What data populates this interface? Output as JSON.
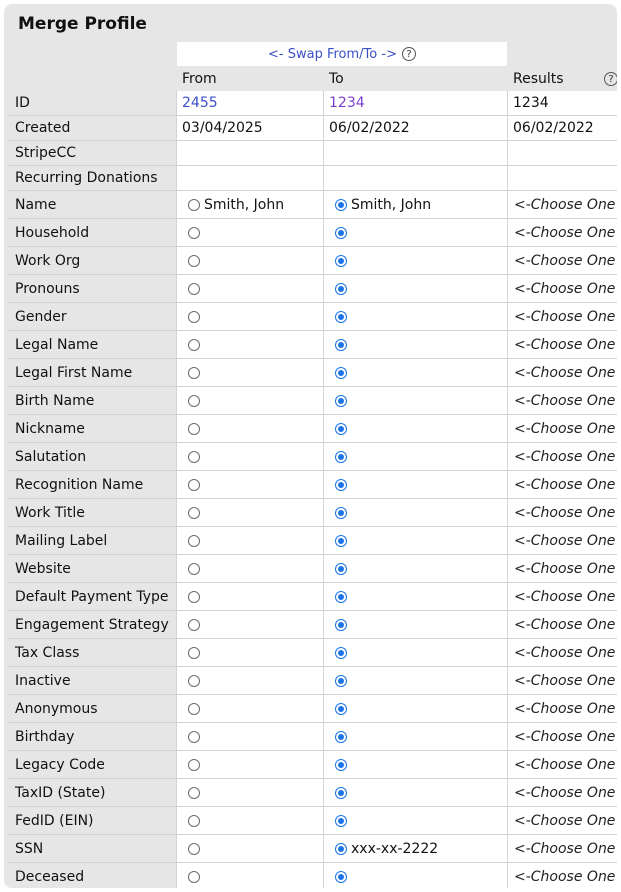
{
  "title": "Merge Profile",
  "swap": {
    "label": "<- Swap From/To ->",
    "help_icon": "?"
  },
  "columns": {
    "from": "From",
    "to": "To",
    "results": "Results"
  },
  "top_rows": [
    {
      "label": "ID",
      "from": "2455",
      "to": "1234",
      "result": "1234"
    },
    {
      "label": "Created",
      "from": "03/04/2025",
      "to": "06/02/2022",
      "result": "06/02/2022"
    },
    {
      "label": "StripeCC",
      "from": "",
      "to": "",
      "result": ""
    },
    {
      "label": "Recurring Donations",
      "from": "",
      "to": "",
      "result": ""
    }
  ],
  "choose_label": "<-Choose One",
  "fields": [
    {
      "label": "Name",
      "from_text": "Smith, John",
      "to_text": "Smith, John",
      "selected": "to"
    },
    {
      "label": "Household",
      "from_text": "",
      "to_text": "",
      "selected": "to"
    },
    {
      "label": "Work Org",
      "from_text": "",
      "to_text": "",
      "selected": "to"
    },
    {
      "label": "Pronouns",
      "from_text": "",
      "to_text": "",
      "selected": "to"
    },
    {
      "label": "Gender",
      "from_text": "",
      "to_text": "",
      "selected": "to"
    },
    {
      "label": "Legal Name",
      "from_text": "",
      "to_text": "",
      "selected": "to"
    },
    {
      "label": "Legal First Name",
      "from_text": "",
      "to_text": "",
      "selected": "to"
    },
    {
      "label": "Birth Name",
      "from_text": "",
      "to_text": "",
      "selected": "to"
    },
    {
      "label": "Nickname",
      "from_text": "",
      "to_text": "",
      "selected": "to"
    },
    {
      "label": "Salutation",
      "from_text": "",
      "to_text": "",
      "selected": "to"
    },
    {
      "label": "Recognition Name",
      "from_text": "",
      "to_text": "",
      "selected": "to"
    },
    {
      "label": "Work Title",
      "from_text": "",
      "to_text": "",
      "selected": "to"
    },
    {
      "label": "Mailing Label",
      "from_text": "",
      "to_text": "",
      "selected": "to"
    },
    {
      "label": "Website",
      "from_text": "",
      "to_text": "",
      "selected": "to"
    },
    {
      "label": "Default Payment Type",
      "from_text": "",
      "to_text": "",
      "selected": "to"
    },
    {
      "label": "Engagement Strategy",
      "from_text": "",
      "to_text": "",
      "selected": "to"
    },
    {
      "label": "Tax Class",
      "from_text": "",
      "to_text": "",
      "selected": "to"
    },
    {
      "label": "Inactive",
      "from_text": "",
      "to_text": "",
      "selected": "to"
    },
    {
      "label": "Anonymous",
      "from_text": "",
      "to_text": "",
      "selected": "to"
    },
    {
      "label": "Birthday",
      "from_text": "",
      "to_text": "",
      "selected": "to"
    },
    {
      "label": "Legacy Code",
      "from_text": "",
      "to_text": "",
      "selected": "to"
    },
    {
      "label": "TaxID (State)",
      "from_text": "",
      "to_text": "",
      "selected": "to"
    },
    {
      "label": "FedID (EIN)",
      "from_text": "",
      "to_text": "",
      "selected": "to"
    },
    {
      "label": "SSN",
      "from_text": "",
      "to_text": "xxx-xx-2222",
      "selected": "to"
    },
    {
      "label": "Deceased",
      "from_text": "",
      "to_text": "",
      "selected": "to"
    }
  ],
  "colors": {
    "link_from": "#3b4fc7",
    "link_to": "#7b3fcf",
    "radio_selected": "#1a73e8",
    "panel_bg": "#e6e6e6"
  }
}
